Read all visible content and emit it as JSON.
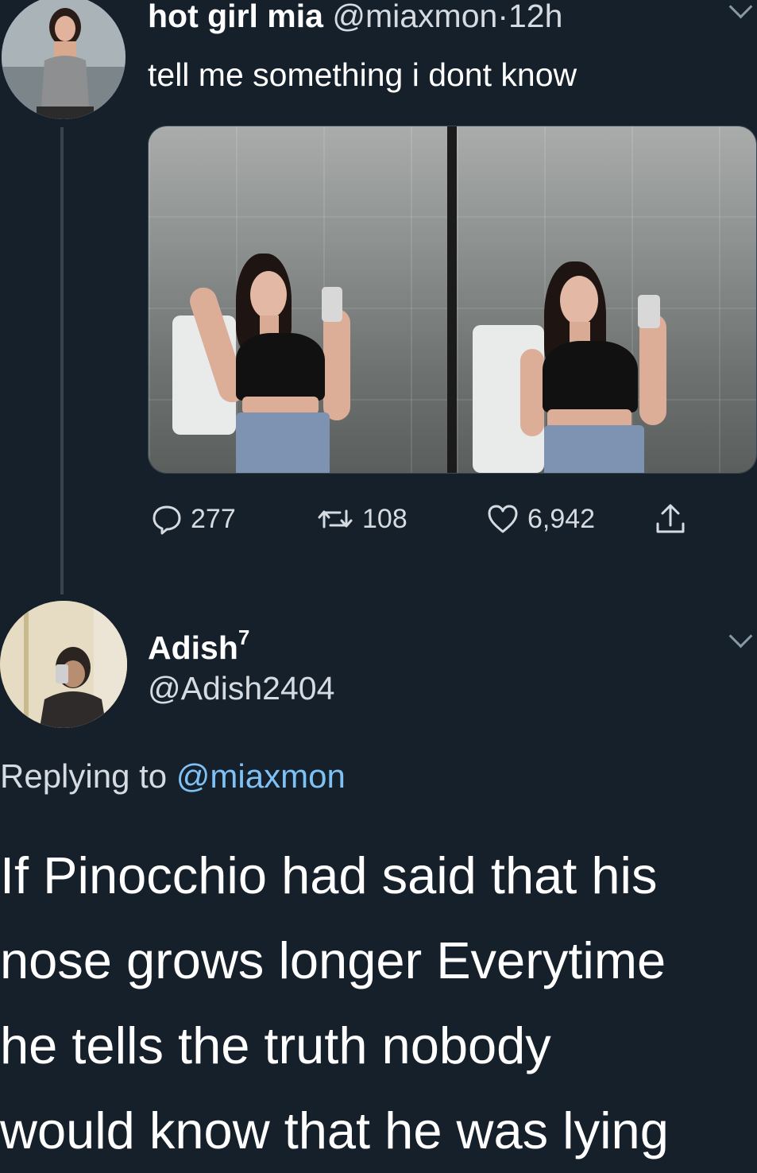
{
  "tweet": {
    "display_name": "hot girl mia",
    "handle": "@miaxmon",
    "separator": "·",
    "time": "12h",
    "text": "tell me something i dont know",
    "stats": {
      "replies": "277",
      "retweets": "108",
      "likes": "6,942"
    }
  },
  "reply": {
    "display_name": "Adish",
    "name_superscript": "7",
    "handle": "@Adish2404",
    "replying_prefix": "Replying to",
    "replying_mention": "@miaxmon",
    "text_lines": [
      "If Pinocchio had said that his",
      "nose grows longer Everytime",
      "he tells the truth nobody",
      "would know that he was lying"
    ]
  },
  "icons": {
    "reply": "reply-icon",
    "retweet": "retweet-icon",
    "like": "heart-icon",
    "share": "share-icon",
    "more": "chevron-down-icon"
  },
  "colors": {
    "background": "#15202b",
    "text": "#ffffff",
    "muted": "#d5dbe0",
    "mention": "#7ec2f5",
    "thread_line": "#38444d"
  }
}
